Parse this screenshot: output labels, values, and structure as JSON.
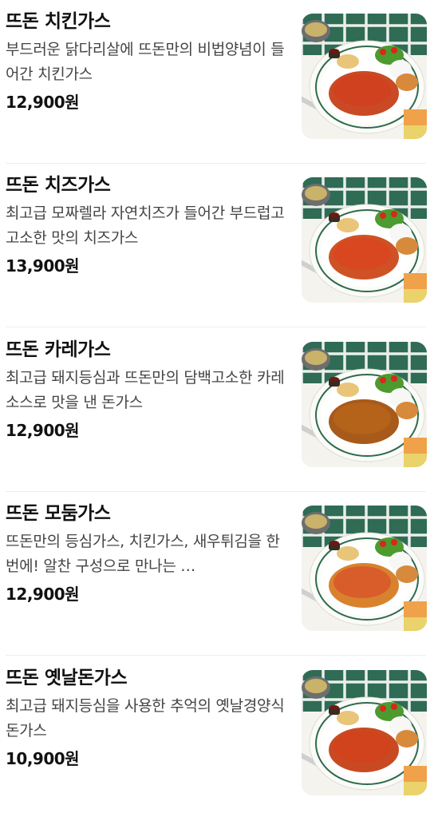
{
  "menu": {
    "items": [
      {
        "name": "뜨돈 치킨가스",
        "description": "부드러운 닭다리살에 뜨돈만의 비법양념이 들어간 치킨가스",
        "price": "12,900원",
        "image": "chicken-katsu-photo",
        "sauce_color": "#d1401f",
        "cutlet_color": "#c94a24"
      },
      {
        "name": "뜨돈 치즈가스",
        "description": "최고급 모짜렐라 자연치즈가 들어간 부드럽고 고소한 맛의 치즈가스",
        "price": "13,900원",
        "image": "cheese-katsu-photo",
        "sauce_color": "#d9451e",
        "cutlet_color": "#cf5226"
      },
      {
        "name": "뜨돈 카레가스",
        "description": "최고급 돼지등심과 뜨돈만의 담백고소한 카레소스로 맛을 낸 돈가스",
        "price": "12,900원",
        "image": "curry-katsu-photo",
        "sauce_color": "#b7651c",
        "cutlet_color": "#a85a1a"
      },
      {
        "name": "뜨돈 모둠가스",
        "description": "뜨돈만의 등심가스, 치킨가스, 새우튀김을 한번에! 알찬 구성으로 만나는 …",
        "price": "12,900원",
        "image": "mixed-katsu-photo",
        "sauce_color": "#d9562a",
        "cutlet_color": "#d8822e"
      },
      {
        "name": "뜨돈 옛날돈가스",
        "description": "최고급 돼지등심을 사용한 추억의 옛날경양식 돈가스",
        "price": "10,900원",
        "image": "classic-katsu-photo",
        "sauce_color": "#d2421c",
        "cutlet_color": "#c84a22"
      }
    ]
  }
}
